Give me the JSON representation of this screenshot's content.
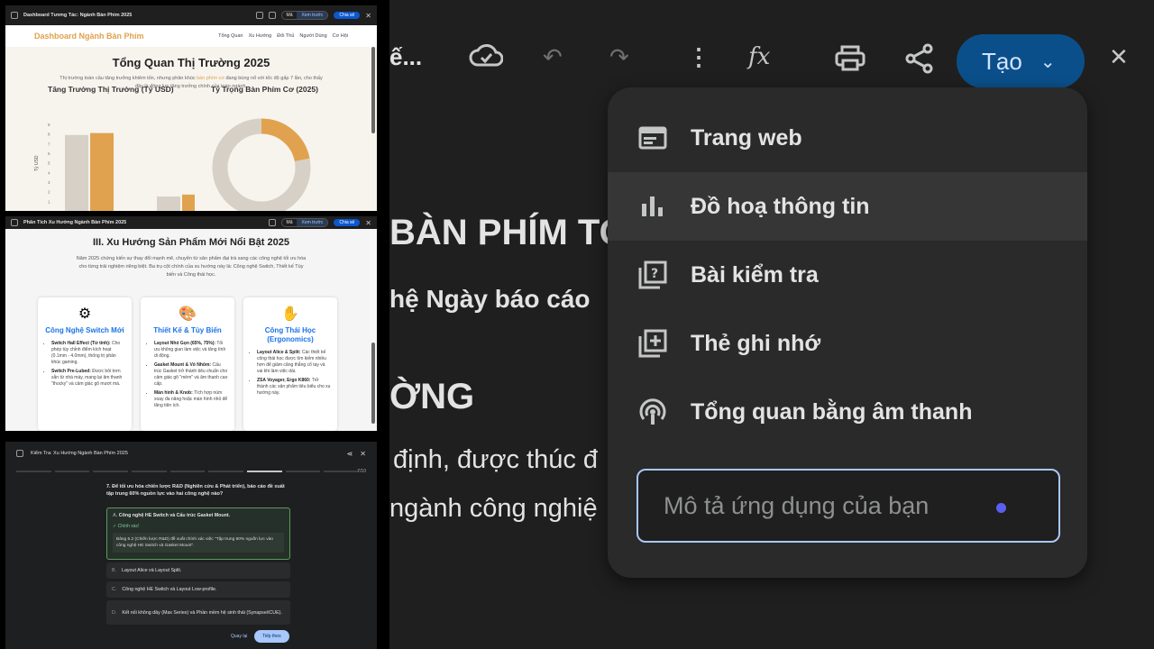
{
  "p1": {
    "window_title": "Dashboard Tương Tác: Ngành Bàn Phím 2025",
    "seg_code": "Mã",
    "seg_preview": "Xem trước",
    "share": "Chia sẻ",
    "brand": "Dashboard Ngành Bàn Phím",
    "nav": [
      "Tổng Quan",
      "Xu Hướng",
      "Đối Thủ",
      "Người Dùng",
      "Cơ Hội"
    ],
    "title": "Tổng Quan Thị Trường 2025",
    "subtitle_a": "Thị trường toàn cầu tăng trưởng khiêm tốn, nhưng phân khúc ",
    "subtitle_em": "bàn phím cơ",
    "subtitle_b": " đang bùng nổ với tốc độ gấp 7 lần, cho thấy đây là động lực tăng trưởng chính của toàn ngành.",
    "chart1_title": "Tăng Trưởng Thị Trường (Tỷ USD)",
    "chart2_title": "Tỷ Trọng Bàn Phím Cơ (2025)",
    "y_axis_label": "Tỷ USD",
    "y_ticks": [
      "9",
      "8",
      "7",
      "6",
      "5",
      "4",
      "3",
      "2",
      "1"
    ]
  },
  "chart_data": [
    {
      "type": "bar",
      "title": "Tăng Trưởng Thị Trường (Tỷ USD)",
      "ylabel": "Tỷ USD",
      "ylim": [
        0,
        9
      ],
      "categories": [
        "",
        ""
      ],
      "series": [
        {
          "values": [
            7.9,
            1.5
          ],
          "color": "#d6d0c6"
        },
        {
          "values": [
            8.1,
            1.7
          ],
          "color": "#e0a24e"
        }
      ]
    },
    {
      "type": "pie",
      "title": "Tỷ Trọng Bàn Phím Cơ (2025)",
      "values": [
        22,
        78
      ],
      "colors": [
        "#e0a24e",
        "#d6d0c6"
      ]
    }
  ],
  "p2": {
    "window_title": "Phân Tích Xu Hướng Ngành Bàn Phím 2025",
    "seg_code": "Mã",
    "seg_preview": "Xem trước",
    "share": "Chia sẻ",
    "title": "III. Xu Hướng Sản Phẩm Mới Nổi Bật 2025",
    "subtitle": "Năm 2025 chứng kiến sự thay đổi mạnh mẽ, chuyển từ sản phẩm đại trà sang các công nghệ tối ưu hóa cho từng trải nghiệm riêng biệt. Ba trụ cột chính của xu hướng này là: Công nghệ Switch, Thiết kế Tùy biến và Công thái học.",
    "cards": [
      {
        "icon": "⚙",
        "title": "Công Nghệ Switch Mới",
        "items": [
          {
            "b": "Switch Hall Effect (Từ tính):",
            "t": " Cho phép tùy chỉnh điểm kích hoạt (0.1mm - 4.0mm), thống trị phân khúc gaming."
          },
          {
            "b": "Switch Pre-Lubed:",
            "t": " Được bôi trơn sẵn từ nhà máy, mang lại âm thanh \"thocky\" và cảm giác gõ mượt mà."
          }
        ]
      },
      {
        "icon": "🎨",
        "title": "Thiết Kế & Tùy Biến",
        "items": [
          {
            "b": "Layout Nhỏ Gọn (65%, 75%):",
            "t": " Tối ưu không gian làm việc và tăng tính di động."
          },
          {
            "b": "Gasket Mount & Vỏ Nhôm:",
            "t": " Cấu trúc Gasket trở thành tiêu chuẩn cho cảm giác gõ \"mềm\" và âm thanh cao cấp."
          },
          {
            "b": "Màn hình & Knob:",
            "t": " Tích hợp núm xoay đa năng hoặc màn hình nhỏ để tăng tiện ích."
          }
        ]
      },
      {
        "icon": "✋",
        "title": "Công Thái Học (Ergonomics)",
        "items": [
          {
            "b": "Layout Alice & Split:",
            "t": " Các thiết kế công thái học được tìm kiếm nhiều hơn để giảm căng thẳng cổ tay và vai khi làm việc dài."
          },
          {
            "b": "ZSA Voyager, Ergo K860:",
            "t": " Trở thành các sản phẩm tiêu biểu cho xu hướng này."
          }
        ]
      }
    ]
  },
  "p3": {
    "window_title": "Kiểm Tra: Xu Hướng Ngành Bàn Phím 2025",
    "progress": "7/10",
    "question_num": "7.",
    "question": "Để tối ưu hóa chiến lược R&D (Nghiên cứu & Phát triển), báo cáo đề xuất tập trung 60% nguồn lực vào hai công nghệ nào?",
    "options": [
      {
        "letter": "A.",
        "text": "Công nghệ HE Switch và Cấu trúc Gasket Mount."
      },
      {
        "letter": "B.",
        "text": "Layout Alice và Layout Split."
      },
      {
        "letter": "C.",
        "text": "Công nghệ HE Switch và Layout Low-profile."
      },
      {
        "letter": "D.",
        "text": "Kết nối không dây (Max Series) và Phần mềm hệ sinh thái (Synapse/iCUE)."
      }
    ],
    "correct_label": "✓ Chính xác!",
    "explanation": "Bảng 5.2 (Chiến lược R&D) đề xuất chính xác việc \"Tập trung 60% nguồn lực vào công nghệ HE Switch và Gasket Mount\".",
    "back": "Quay lại",
    "next": "Tiếp theo"
  },
  "right": {
    "doc_title_cut": "ế...",
    "create_label": "Tạo",
    "doc_lines": [
      "BÀN PHÍM TO",
      "hệ Ngày báo cáo",
      "ỜNG",
      "định, được thúc đ",
      "ngành công nghiệ"
    ],
    "menu_items": [
      {
        "icon": "web-icon",
        "label": "Trang web"
      },
      {
        "icon": "bar-chart-icon",
        "label": "Đồ hoạ thông tin"
      },
      {
        "icon": "quiz-icon",
        "label": "Bài kiểm tra"
      },
      {
        "icon": "flashcard-icon",
        "label": "Thẻ ghi nhớ"
      },
      {
        "icon": "podcast-icon",
        "label": "Tổng quan bằng âm thanh"
      }
    ],
    "describe_placeholder": "Mô tả ứng dụng của bạn"
  }
}
